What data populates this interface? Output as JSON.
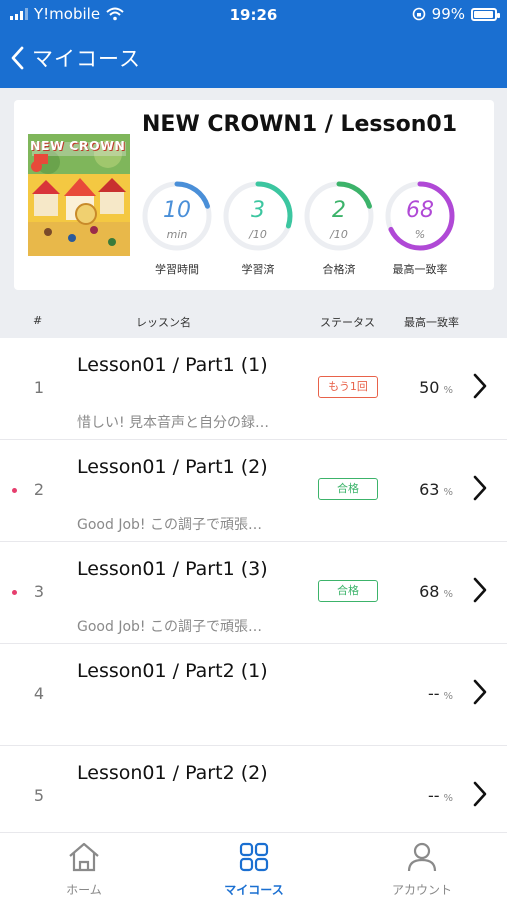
{
  "status_bar": {
    "carrier": "Y!mobile",
    "time": "19:26",
    "battery": "99%"
  },
  "header": {
    "back_label": "マイコース"
  },
  "course": {
    "title": "NEW CROWN1 / Lesson01",
    "cover_text": "NEW CROWN",
    "stats": [
      {
        "value": "10",
        "unit": "min",
        "label": "学習時間",
        "color": "#4a8fd8",
        "fraction": 0.2
      },
      {
        "value": "3",
        "unit": "/10",
        "label": "学習済",
        "color": "#3cc6a0",
        "fraction": 0.3
      },
      {
        "value": "2",
        "unit": "/10",
        "label": "合格済",
        "color": "#3cb36a",
        "fraction": 0.2
      },
      {
        "value": "68",
        "unit": "%",
        "label": "最高一致率",
        "color": "#b049d6",
        "fraction": 0.68
      }
    ]
  },
  "columns": {
    "index": "#",
    "lesson": "レッスン名",
    "status": "ステータス",
    "match": "最高一致率"
  },
  "lessons": [
    {
      "index": "1",
      "title": "Lesson01 / Part1 (1)",
      "message": "惜しい! 見本音声と自分の録…",
      "status": "もう1回",
      "score": "50",
      "unit": "%"
    },
    {
      "index": "2",
      "title": "Lesson01 / Part1 (2)",
      "message": "Good Job! この調子で頑張…",
      "status": "合格",
      "score": "63",
      "unit": "%"
    },
    {
      "index": "3",
      "title": "Lesson01 / Part1 (3)",
      "message": "Good Job! この調子で頑張…",
      "status": "合格",
      "score": "68",
      "unit": "%"
    },
    {
      "index": "4",
      "title": "Lesson01 / Part2 (1)",
      "message": "",
      "status": "",
      "score": "--",
      "unit": "%"
    },
    {
      "index": "5",
      "title": "Lesson01 / Part2 (2)",
      "message": "",
      "status": "",
      "score": "--",
      "unit": "%"
    }
  ],
  "tabbar": {
    "home": "ホーム",
    "mycourse": "マイコース",
    "account": "アカウント"
  },
  "colors": {
    "brand": "#1a6fd1",
    "retry": "#e8624a",
    "pass": "#3cb36a",
    "new_dot": "#e63e6d"
  }
}
